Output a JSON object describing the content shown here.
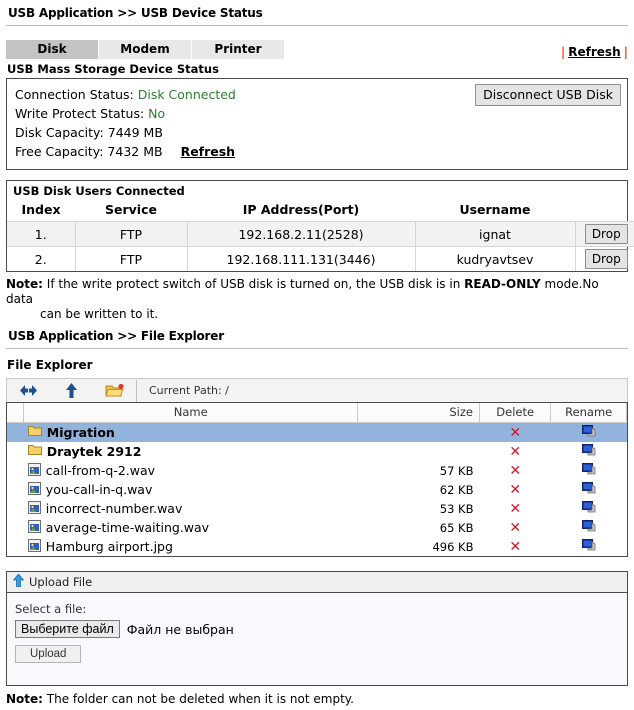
{
  "device_status": {
    "breadcrumb": "USB Application >> USB Device Status",
    "tabs": [
      {
        "label": "Disk",
        "active": true
      },
      {
        "label": "Modem",
        "active": false
      },
      {
        "label": "Printer",
        "active": false
      }
    ],
    "top_refresh_label": "Refresh",
    "separator": "|",
    "section_caption": "USB Mass Storage Device Status",
    "connection_status_label": "Connection Status:",
    "connection_status_value": "Disk Connected",
    "write_protect_label": "Write Protect Status:",
    "write_protect_value": "No",
    "disk_capacity_label": "Disk Capacity:",
    "disk_capacity_value": "7449 MB",
    "free_capacity_label": "Free Capacity:",
    "free_capacity_value": "7432 MB",
    "inline_refresh_label": "Refresh",
    "disconnect_button": "Disconnect USB Disk",
    "status_color": "#2e7d32"
  },
  "users": {
    "title": "USB Disk Users Connected",
    "columns": [
      "Index",
      "Service",
      "IP Address(Port)",
      "Username"
    ],
    "action_label": "Drop",
    "rows": [
      {
        "index": "1.",
        "service": "FTP",
        "ip": "192.168.2.11(2528)",
        "username": "ignat",
        "action": "Drop"
      },
      {
        "index": "2.",
        "service": "FTP",
        "ip": "192.168.111.131(3446)",
        "username": "kudryavtsev",
        "action": "Drop"
      }
    ],
    "note_prefix": "Note:",
    "note_part1": " If the write protect switch of USB disk is turned on, the USB disk is in ",
    "note_strong": "READ-ONLY",
    "note_part2": " mode.No data",
    "note_line2": "can be written to it."
  },
  "file_explorer": {
    "breadcrumb": "USB Application >> File Explorer",
    "caption": "File Explorer",
    "toolbar": {
      "refresh_icon": "refresh-icon",
      "up_icon": "up-arrow-icon",
      "new_folder_icon": "new-folder-icon",
      "current_path_label": "Current Path: /"
    },
    "columns": [
      "Name",
      "Size",
      "Delete",
      "Rename"
    ],
    "delete_glyph": "✕",
    "rows": [
      {
        "name": "Migration",
        "size": "",
        "type": "folder",
        "selected": true
      },
      {
        "name": "Draytek 2912",
        "size": "",
        "type": "folder",
        "selected": false
      },
      {
        "name": "call-from-q-2.wav",
        "size": "57 KB",
        "type": "file",
        "selected": false
      },
      {
        "name": "you-call-in-q.wav",
        "size": "62 KB",
        "type": "file",
        "selected": false
      },
      {
        "name": "incorrect-number.wav",
        "size": "53 KB",
        "type": "file",
        "selected": false
      },
      {
        "name": "average-time-waiting.wav",
        "size": "65 KB",
        "type": "file",
        "selected": false
      },
      {
        "name": "Hamburg airport.jpg",
        "size": "496 KB",
        "type": "file",
        "selected": false
      }
    ],
    "selection_color": "#92b3db",
    "delete_color": "#cc1b2e"
  },
  "upload": {
    "header": "Upload File",
    "select_label": "Select a file:",
    "choose_button": "Выберите файл",
    "no_file_text": "Файл не выбран",
    "upload_button": "Upload",
    "note_prefix": "Note:",
    "note_text": " The folder can not be deleted when it is not empty."
  }
}
